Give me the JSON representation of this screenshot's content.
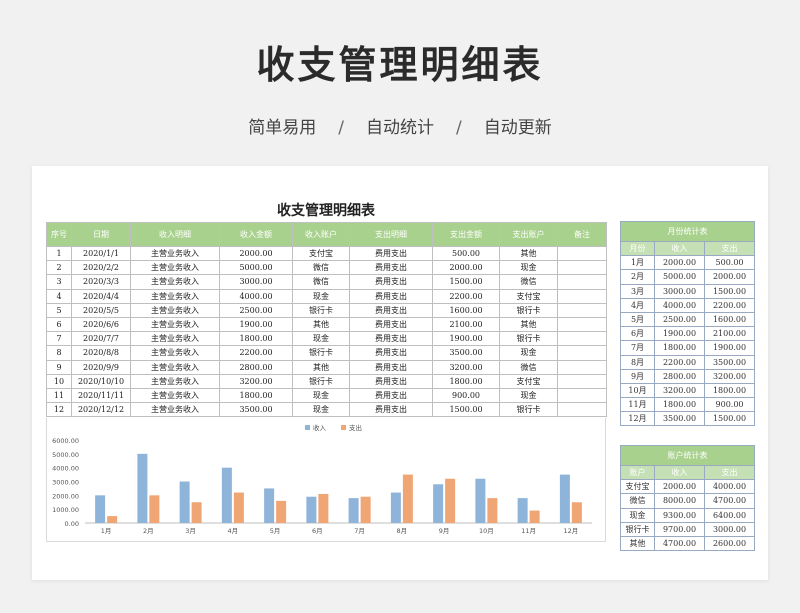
{
  "hero": {
    "title": "收支管理明细表",
    "subtitles": [
      "简单易用",
      "自动统计",
      "自动更新"
    ],
    "separator": "/"
  },
  "sheet": {
    "title": "收支管理明细表"
  },
  "main_table": {
    "headers": [
      "序号",
      "日期",
      "收入明细",
      "收入金额",
      "收入账户",
      "支出明细",
      "支出金额",
      "支出账户",
      "备注"
    ],
    "rows": [
      [
        "1",
        "2020/1/1",
        "主营业务收入",
        "2000.00",
        "支付宝",
        "费用支出",
        "500.00",
        "其他",
        ""
      ],
      [
        "2",
        "2020/2/2",
        "主营业务收入",
        "5000.00",
        "微信",
        "费用支出",
        "2000.00",
        "现金",
        ""
      ],
      [
        "3",
        "2020/3/3",
        "主营业务收入",
        "3000.00",
        "微信",
        "费用支出",
        "1500.00",
        "微信",
        ""
      ],
      [
        "4",
        "2020/4/4",
        "主营业务收入",
        "4000.00",
        "现金",
        "费用支出",
        "2200.00",
        "支付宝",
        ""
      ],
      [
        "5",
        "2020/5/5",
        "主营业务收入",
        "2500.00",
        "银行卡",
        "费用支出",
        "1600.00",
        "银行卡",
        ""
      ],
      [
        "6",
        "2020/6/6",
        "主营业务收入",
        "1900.00",
        "其他",
        "费用支出",
        "2100.00",
        "其他",
        ""
      ],
      [
        "7",
        "2020/7/7",
        "主营业务收入",
        "1800.00",
        "现金",
        "费用支出",
        "1900.00",
        "银行卡",
        ""
      ],
      [
        "8",
        "2020/8/8",
        "主营业务收入",
        "2200.00",
        "银行卡",
        "费用支出",
        "3500.00",
        "现金",
        ""
      ],
      [
        "9",
        "2020/9/9",
        "主营业务收入",
        "2800.00",
        "其他",
        "费用支出",
        "3200.00",
        "微信",
        ""
      ],
      [
        "10",
        "2020/10/10",
        "主营业务收入",
        "3200.00",
        "银行卡",
        "费用支出",
        "1800.00",
        "支付宝",
        ""
      ],
      [
        "11",
        "2020/11/11",
        "主营业务收入",
        "1800.00",
        "现金",
        "费用支出",
        "900.00",
        "现金",
        ""
      ],
      [
        "12",
        "2020/12/12",
        "主营业务收入",
        "3500.00",
        "现金",
        "费用支出",
        "1500.00",
        "银行卡",
        ""
      ]
    ]
  },
  "monthly_stats": {
    "caption": "月份统计表",
    "headers": [
      "月份",
      "收入",
      "支出"
    ],
    "rows": [
      [
        "1月",
        "2000.00",
        "500.00"
      ],
      [
        "2月",
        "5000.00",
        "2000.00"
      ],
      [
        "3月",
        "3000.00",
        "1500.00"
      ],
      [
        "4月",
        "4000.00",
        "2200.00"
      ],
      [
        "5月",
        "2500.00",
        "1600.00"
      ],
      [
        "6月",
        "1900.00",
        "2100.00"
      ],
      [
        "7月",
        "1800.00",
        "1900.00"
      ],
      [
        "8月",
        "2200.00",
        "3500.00"
      ],
      [
        "9月",
        "2800.00",
        "3200.00"
      ],
      [
        "10月",
        "3200.00",
        "1800.00"
      ],
      [
        "11月",
        "1800.00",
        "900.00"
      ],
      [
        "12月",
        "3500.00",
        "1500.00"
      ]
    ]
  },
  "account_stats": {
    "caption": "账户统计表",
    "headers": [
      "账户",
      "收入",
      "支出"
    ],
    "rows": [
      [
        "支付宝",
        "2000.00",
        "4000.00"
      ],
      [
        "微信",
        "8000.00",
        "4700.00"
      ],
      [
        "现金",
        "9300.00",
        "6400.00"
      ],
      [
        "银行卡",
        "9700.00",
        "3000.00"
      ],
      [
        "其他",
        "4700.00",
        "2600.00"
      ]
    ]
  },
  "colors": {
    "income": "#8fb4d9",
    "expense": "#f0a574",
    "header_green": "#a9d18e"
  },
  "chart_data": {
    "type": "bar",
    "categories": [
      "1月",
      "2月",
      "3月",
      "4月",
      "5月",
      "6月",
      "7月",
      "8月",
      "9月",
      "10月",
      "11月",
      "12月"
    ],
    "series": [
      {
        "name": "收入",
        "values": [
          2000,
          5000,
          3000,
          4000,
          2500,
          1900,
          1800,
          2200,
          2800,
          3200,
          1800,
          3500
        ]
      },
      {
        "name": "支出",
        "values": [
          500,
          2000,
          1500,
          2200,
          1600,
          2100,
          1900,
          3500,
          3200,
          1800,
          900,
          1500
        ]
      }
    ],
    "yticks": [
      "0.00",
      "1000.00",
      "2000.00",
      "3000.00",
      "4000.00",
      "5000.00",
      "6000.00"
    ],
    "ylim": [
      0,
      6000
    ],
    "legend": "top-center",
    "grid": false
  }
}
